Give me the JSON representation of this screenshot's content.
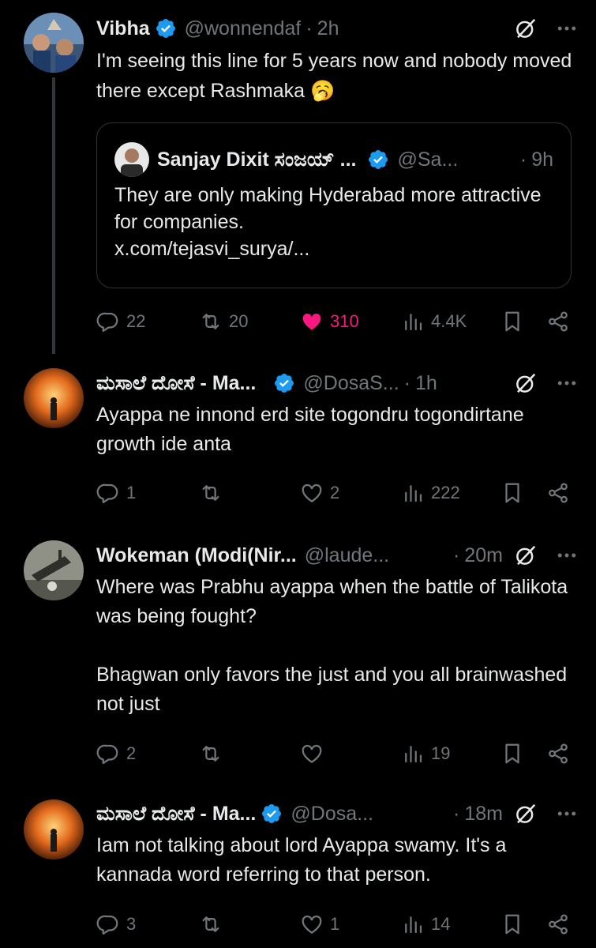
{
  "tweets": [
    {
      "name": "Vibha",
      "handle": "@wonnendaf",
      "time": "2h",
      "text": "I'm seeing this line for 5 years now and nobody moved there except Rashmaka 🥱",
      "quote": {
        "name": "Sanjay Dixit ಸಂಜಯ್ ...",
        "handle": "@Sa...",
        "time": "9h",
        "text": "They are only making Hyderabad more attractive for companies.",
        "link": "x.com/tejasvi_surya/..."
      },
      "replies": "22",
      "reposts": "20",
      "likes": "310",
      "views": "4.4K",
      "liked": true
    },
    {
      "name": "ಮಸಾಲೆ ದೋಸೆ - Ma...",
      "handle": "@DosaS...",
      "time": "1h",
      "text": "Ayappa ne innond erd site togondru togondirtane growth ide anta",
      "replies": "1",
      "reposts": "",
      "likes": "2",
      "views": "222"
    },
    {
      "name": "Wokeman (Modi(Nir...",
      "handle": "@laude...",
      "time": "20m",
      "text": "Where was Prabhu ayappa when the battle of Talikota was being fought?\n\nBhagwan only favors the just and you all brainwashed not just",
      "replies": "2",
      "reposts": "",
      "likes": "",
      "views": "19"
    },
    {
      "name": "ಮಸಾಲೆ ದೋಸೆ - Ma...",
      "handle": "@Dosa...",
      "time": "18m",
      "text": "Iam not talking about lord Ayappa swamy. It's a kannada word referring to that person.",
      "replies": "3",
      "reposts": "",
      "likes": "1",
      "views": "14"
    }
  ],
  "separator": "·",
  "colors": {
    "background": "#000000",
    "text": "#e7e9ea",
    "muted": "#71767b",
    "verified": "#1d9bf0",
    "like": "#f91880",
    "thread_line": "#333639"
  }
}
